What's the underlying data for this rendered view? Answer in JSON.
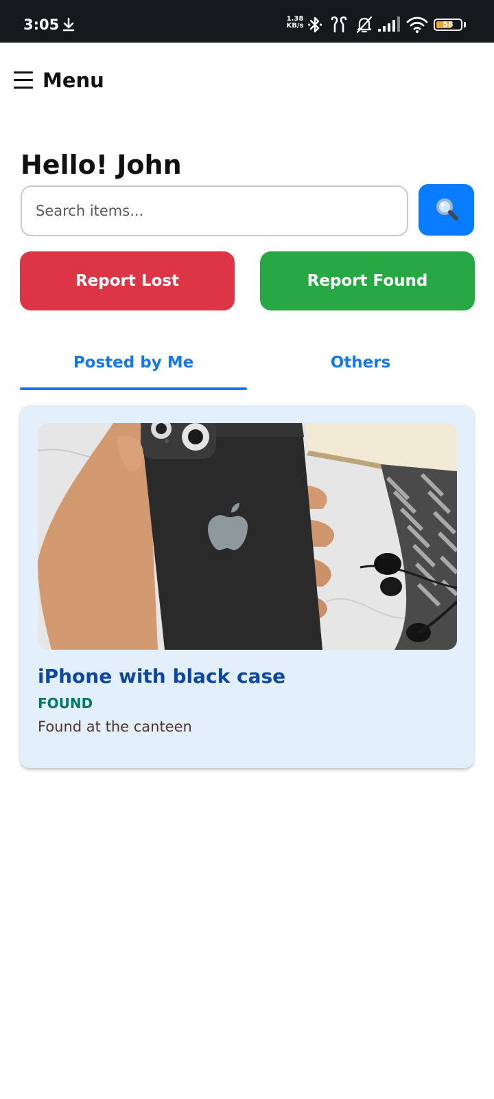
{
  "status_bar": {
    "time": "3:05",
    "net_speed_value": "1.38",
    "net_speed_unit": "KB/s",
    "battery": "58"
  },
  "header": {
    "menu_label": "Menu"
  },
  "greeting": "Hello! John",
  "search": {
    "placeholder": "Search items..."
  },
  "actions": {
    "report_lost": "Report Lost",
    "report_found": "Report Found"
  },
  "tabs": [
    {
      "label": "Posted by Me",
      "active": true
    },
    {
      "label": "Others",
      "active": false
    }
  ],
  "items": [
    {
      "title": "iPhone with black case",
      "status": "FOUND",
      "description": "Found at the canteen"
    }
  ],
  "colors": {
    "primary": "#0a7cff",
    "tab_accent": "#1677e6",
    "lost": "#dc3545",
    "found": "#28a745",
    "card_bg": "#e3f0fc",
    "title": "#0d47a1",
    "status_found": "#00796b"
  }
}
